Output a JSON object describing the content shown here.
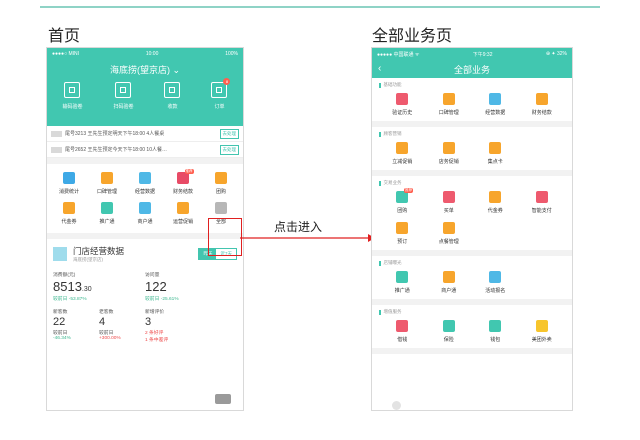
{
  "headings": {
    "home": "首页",
    "all": "全部业务页"
  },
  "arrow_label": "点击进入",
  "home": {
    "status": {
      "left": "●●●●○ MINI",
      "time": "10:00",
      "battery": "100%"
    },
    "store_title": "海底捞(望京店) ⌄",
    "quick_actions": [
      {
        "label": "输码验卷"
      },
      {
        "label": "扫码验卷"
      },
      {
        "label": "收款"
      },
      {
        "label": "订单",
        "badge": "8"
      }
    ],
    "notices": [
      {
        "text": "尾号3213  王先生预定明天下午18:00 4人餐桌",
        "action": "去处理"
      },
      {
        "text": "尾号2652  王先生预定今天下午18:00 10人餐…",
        "action": "去处理"
      }
    ],
    "grid": [
      {
        "label": "消费统计",
        "color": "#3ea9e6"
      },
      {
        "label": "口碑管理",
        "color": "#f7a52c"
      },
      {
        "label": "经营数据",
        "color": "#4fb8e6"
      },
      {
        "label": "财务结款",
        "color": "#e84b66",
        "badge": "推荐"
      },
      {
        "label": "团购",
        "color": "#f7a52c"
      },
      {
        "label": "代金券",
        "color": "#f7a52c"
      },
      {
        "label": "推广通",
        "color": "#41c7b0"
      },
      {
        "label": "商户通",
        "color": "#4fb8e6"
      },
      {
        "label": "运营促销",
        "color": "#f7a52c"
      },
      {
        "label": "全部",
        "color": "#b7b7b7"
      }
    ],
    "stats": {
      "title": "门店经营数据",
      "subtitle": "海底捞(望京店)",
      "tabs": [
        "昨天",
        "近7天"
      ],
      "consumption_label": "消费额(元)",
      "consumption_int": "8513",
      "consumption_dec": ".30",
      "consumption_cmp": "较前日 -53.87%",
      "visits_label": "访问量",
      "visits_value": "122",
      "visits_cmp": "较前日 -25.61%",
      "new_label": "新客数",
      "old_label": "老客数",
      "new_value": "22",
      "old_value": "4",
      "cmp_label1": "较前日",
      "cmp_label2": "较前日",
      "new_cmp": "-46.34%",
      "old_cmp": "+300.00%",
      "review_label": "新增评价",
      "review_value": "3",
      "good_review": "2 条好评",
      "mid_review": "1 条中差评"
    }
  },
  "all": {
    "status": {
      "left": "●●●●● 中国联通 ᯤ",
      "time": "下午9:32",
      "battery": "⊕ ✦ 32%"
    },
    "back": "‹",
    "title": "全部业务",
    "groups": [
      {
        "name": "基础功能",
        "items": [
          {
            "label": "验证历史",
            "color": "#ee5a6e"
          },
          {
            "label": "口碑管理",
            "color": "#f7a52c"
          },
          {
            "label": "经营数据",
            "color": "#4fb8e6"
          },
          {
            "label": "财务结款",
            "color": "#f7a52c"
          }
        ]
      },
      {
        "name": "顾客营销",
        "items": [
          {
            "label": "立减促销",
            "color": "#f7a52c"
          },
          {
            "label": "店务促销",
            "color": "#f7a52c"
          },
          {
            "label": "集点卡",
            "color": "#f7a52c"
          }
        ]
      },
      {
        "name": "交易业务",
        "items": [
          {
            "label": "团购",
            "color": "#41c7b0",
            "badge": "推荐"
          },
          {
            "label": "买单",
            "color": "#ee5a6e"
          },
          {
            "label": "代金券",
            "color": "#f7a52c"
          },
          {
            "label": "智能支付",
            "color": "#ee5a6e"
          },
          {
            "label": "预订",
            "color": "#f7a52c"
          },
          {
            "label": "点餐管理",
            "color": "#f7a52c"
          }
        ]
      },
      {
        "name": "店铺曝光",
        "items": [
          {
            "label": "推广通",
            "color": "#41c7b0"
          },
          {
            "label": "商户通",
            "color": "#f7a52c"
          },
          {
            "label": "活动报名",
            "color": "#4fb8e6"
          }
        ]
      },
      {
        "name": "增值服务",
        "items": [
          {
            "label": "借钱",
            "color": "#ee5a6e"
          },
          {
            "label": "保险",
            "color": "#41c7b0"
          },
          {
            "label": "钱包",
            "color": "#41c7b0"
          },
          {
            "label": "美团外卖",
            "color": "#f7c52c"
          }
        ]
      }
    ]
  }
}
